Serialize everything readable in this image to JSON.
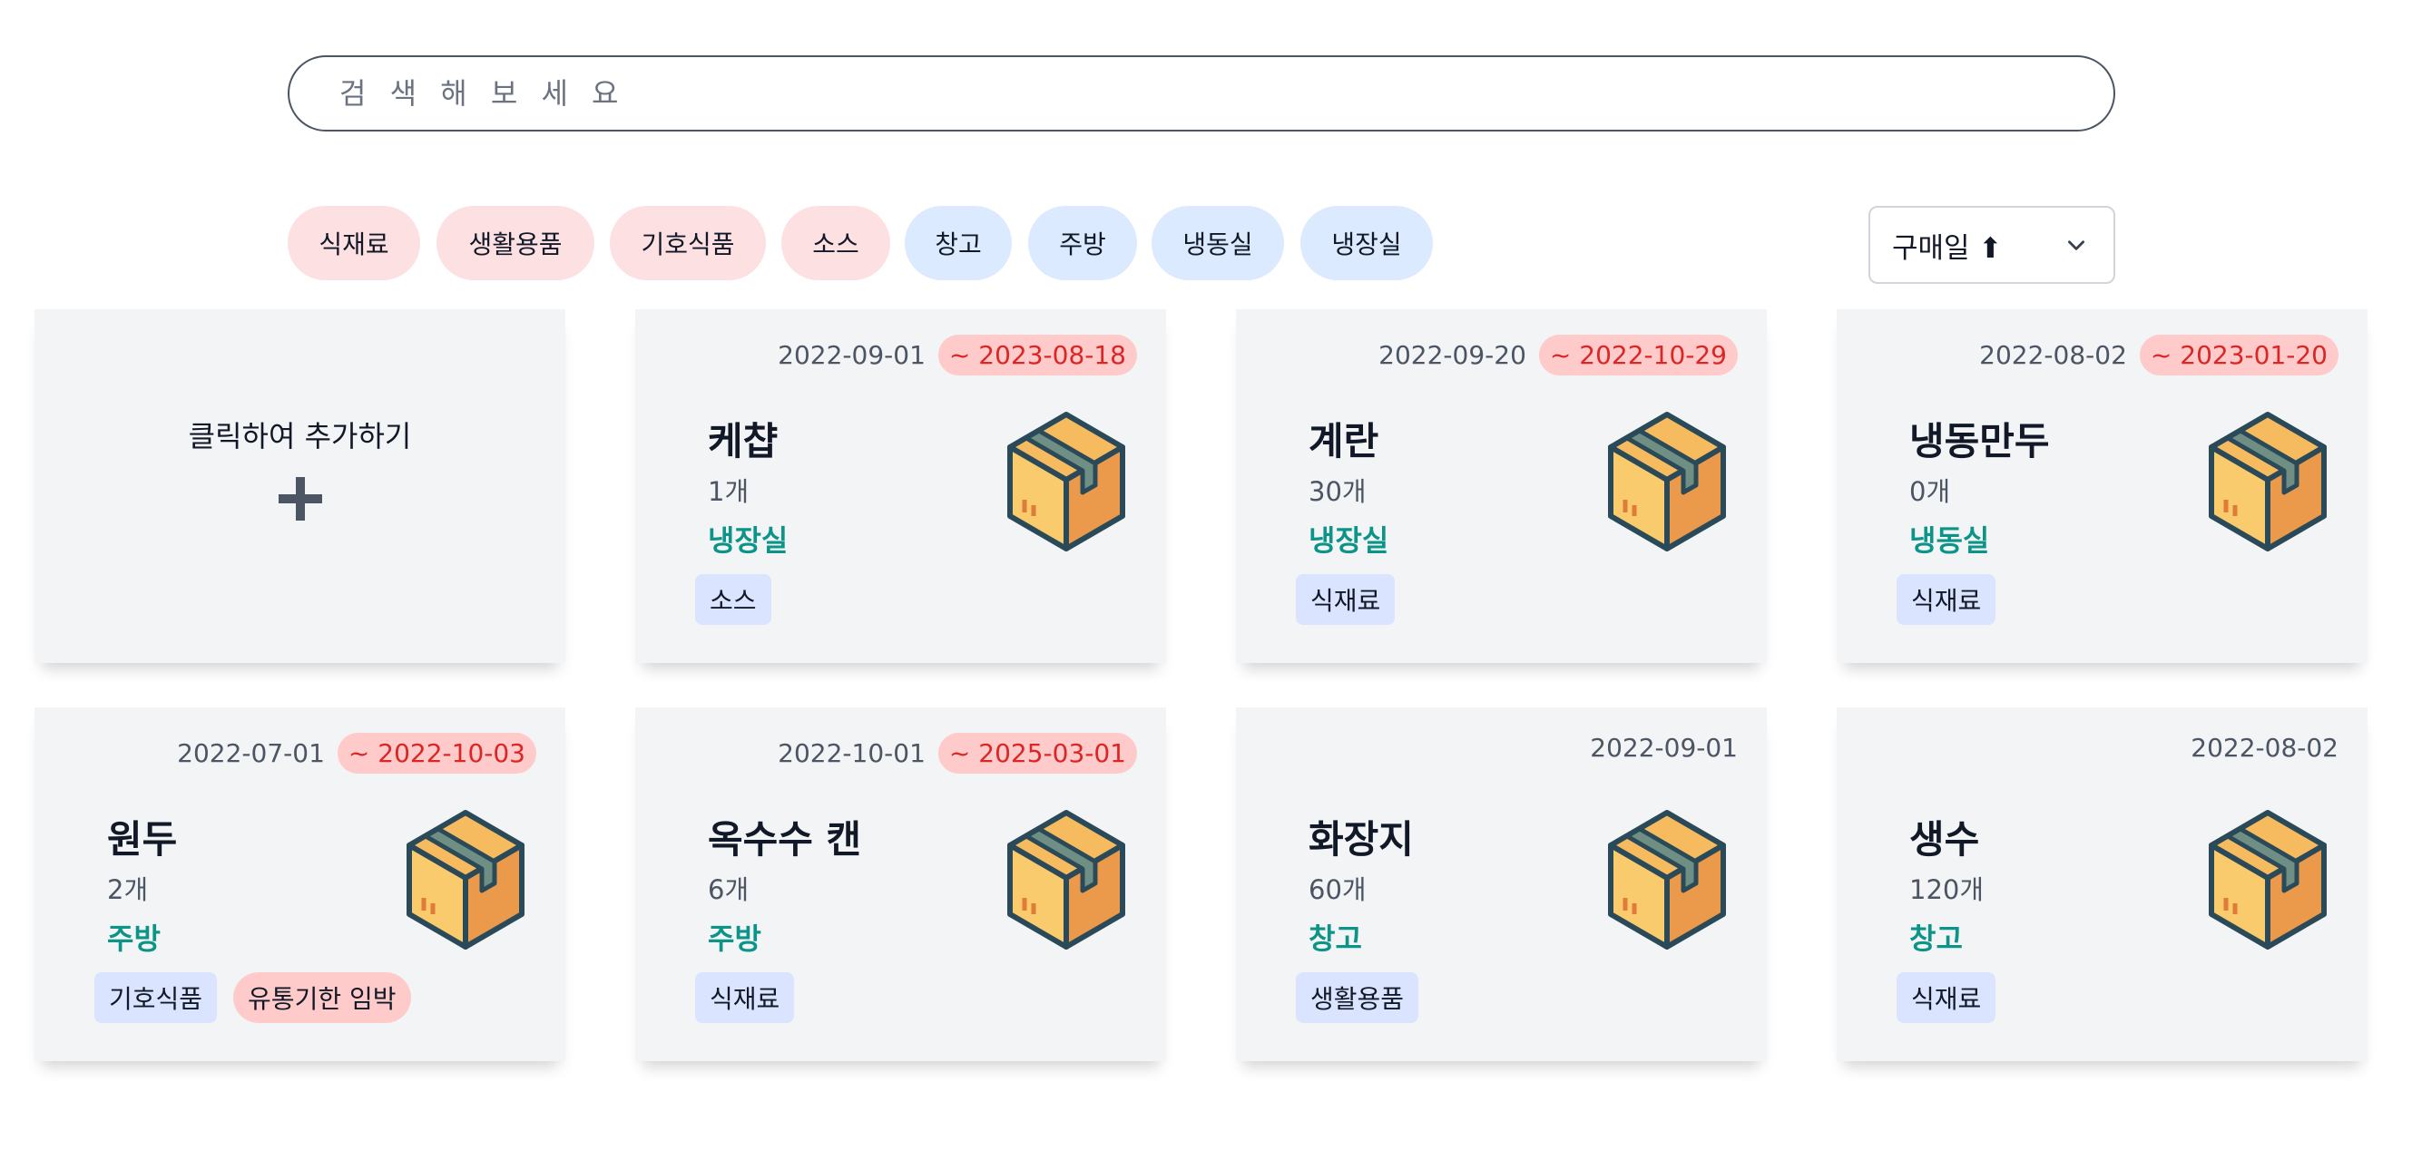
{
  "search": {
    "placeholder": "검 색 해 보 세 요"
  },
  "filters": {
    "categories": [
      "식재료",
      "생활용품",
      "기호식품",
      "소스"
    ],
    "locations": [
      "창고",
      "주방",
      "냉동실",
      "냉장실"
    ]
  },
  "sort": {
    "label": "구매일 ⬆"
  },
  "add_card": {
    "label": "클릭하여 추가하기"
  },
  "items": [
    {
      "purchase_date": "2022-09-01",
      "expiry": "~ 2023-08-18",
      "name": "케챱",
      "qty": "1개",
      "location": "냉장실",
      "tags": [
        "소스"
      ]
    },
    {
      "purchase_date": "2022-09-20",
      "expiry": "~ 2022-10-29",
      "name": "계란",
      "qty": "30개",
      "location": "냉장실",
      "tags": [
        "식재료"
      ]
    },
    {
      "purchase_date": "2022-08-02",
      "expiry": "~ 2023-01-20",
      "name": "냉동만두",
      "qty": "0개",
      "location": "냉동실",
      "tags": [
        "식재료"
      ]
    },
    {
      "purchase_date": "2022-07-01",
      "expiry": "~ 2022-10-03",
      "name": "원두",
      "qty": "2개",
      "location": "주방",
      "tags": [
        "기호식품"
      ],
      "alert": "유통기한 임박"
    },
    {
      "purchase_date": "2022-10-01",
      "expiry": "~ 2025-03-01",
      "name": "옥수수 캔",
      "qty": "6개",
      "location": "주방",
      "tags": [
        "식재료"
      ]
    },
    {
      "purchase_date": "2022-09-01",
      "name": "화장지",
      "qty": "60개",
      "location": "창고",
      "tags": [
        "생활용품"
      ]
    },
    {
      "purchase_date": "2022-08-02",
      "name": "생수",
      "qty": "120개",
      "location": "창고",
      "tags": [
        "식재료"
      ]
    }
  ],
  "colors": {
    "category_chip": "#fde0e2",
    "location_chip": "#dbeafe",
    "expiry_bg": "#fecaca",
    "expiry_text": "#dc2626",
    "location_text": "#0d9488"
  }
}
